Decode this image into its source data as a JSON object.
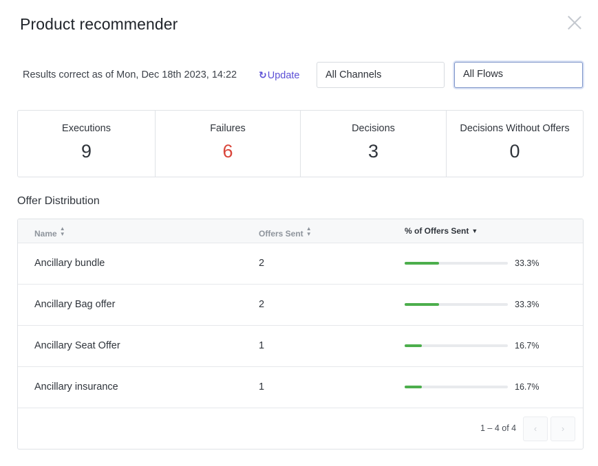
{
  "modal": {
    "title": "Product recommender"
  },
  "toolbar": {
    "results_text": "Results correct as of Mon, Dec 18th 2023, 14:22",
    "update_label": "Update",
    "refresh_icon": "↻",
    "channel_select": "All Channels",
    "flow_select": "All Flows"
  },
  "stats": [
    {
      "label": "Executions",
      "value": "9"
    },
    {
      "label": "Failures",
      "value": "6"
    },
    {
      "label": "Decisions",
      "value": "3"
    },
    {
      "label": "Decisions Without Offers",
      "value": "0"
    }
  ],
  "offer_distribution": {
    "title": "Offer Distribution",
    "columns": {
      "name": "Name",
      "offers_sent": "Offers Sent",
      "pct_sent": "% of Offers Sent"
    },
    "rows": [
      {
        "name": "Ancillary bundle",
        "offers_sent": "2",
        "pct_label": "33.3%",
        "pct": 33.3
      },
      {
        "name": "Ancillary Bag offer",
        "offers_sent": "2",
        "pct_label": "33.3%",
        "pct": 33.3
      },
      {
        "name": "Ancillary Seat Offer",
        "offers_sent": "1",
        "pct_label": "16.7%",
        "pct": 16.7
      },
      {
        "name": "Ancillary insurance",
        "offers_sent": "1",
        "pct_label": "16.7%",
        "pct": 16.7
      }
    ],
    "pagination": {
      "info": "1 – 4 of 4",
      "prev_icon": "‹",
      "next_icon": "›"
    }
  },
  "colors": {
    "accent": "#5b4fd6",
    "failure": "#d9453a",
    "bar_fill": "#4cae4c",
    "bar_track": "#e8eaed"
  }
}
